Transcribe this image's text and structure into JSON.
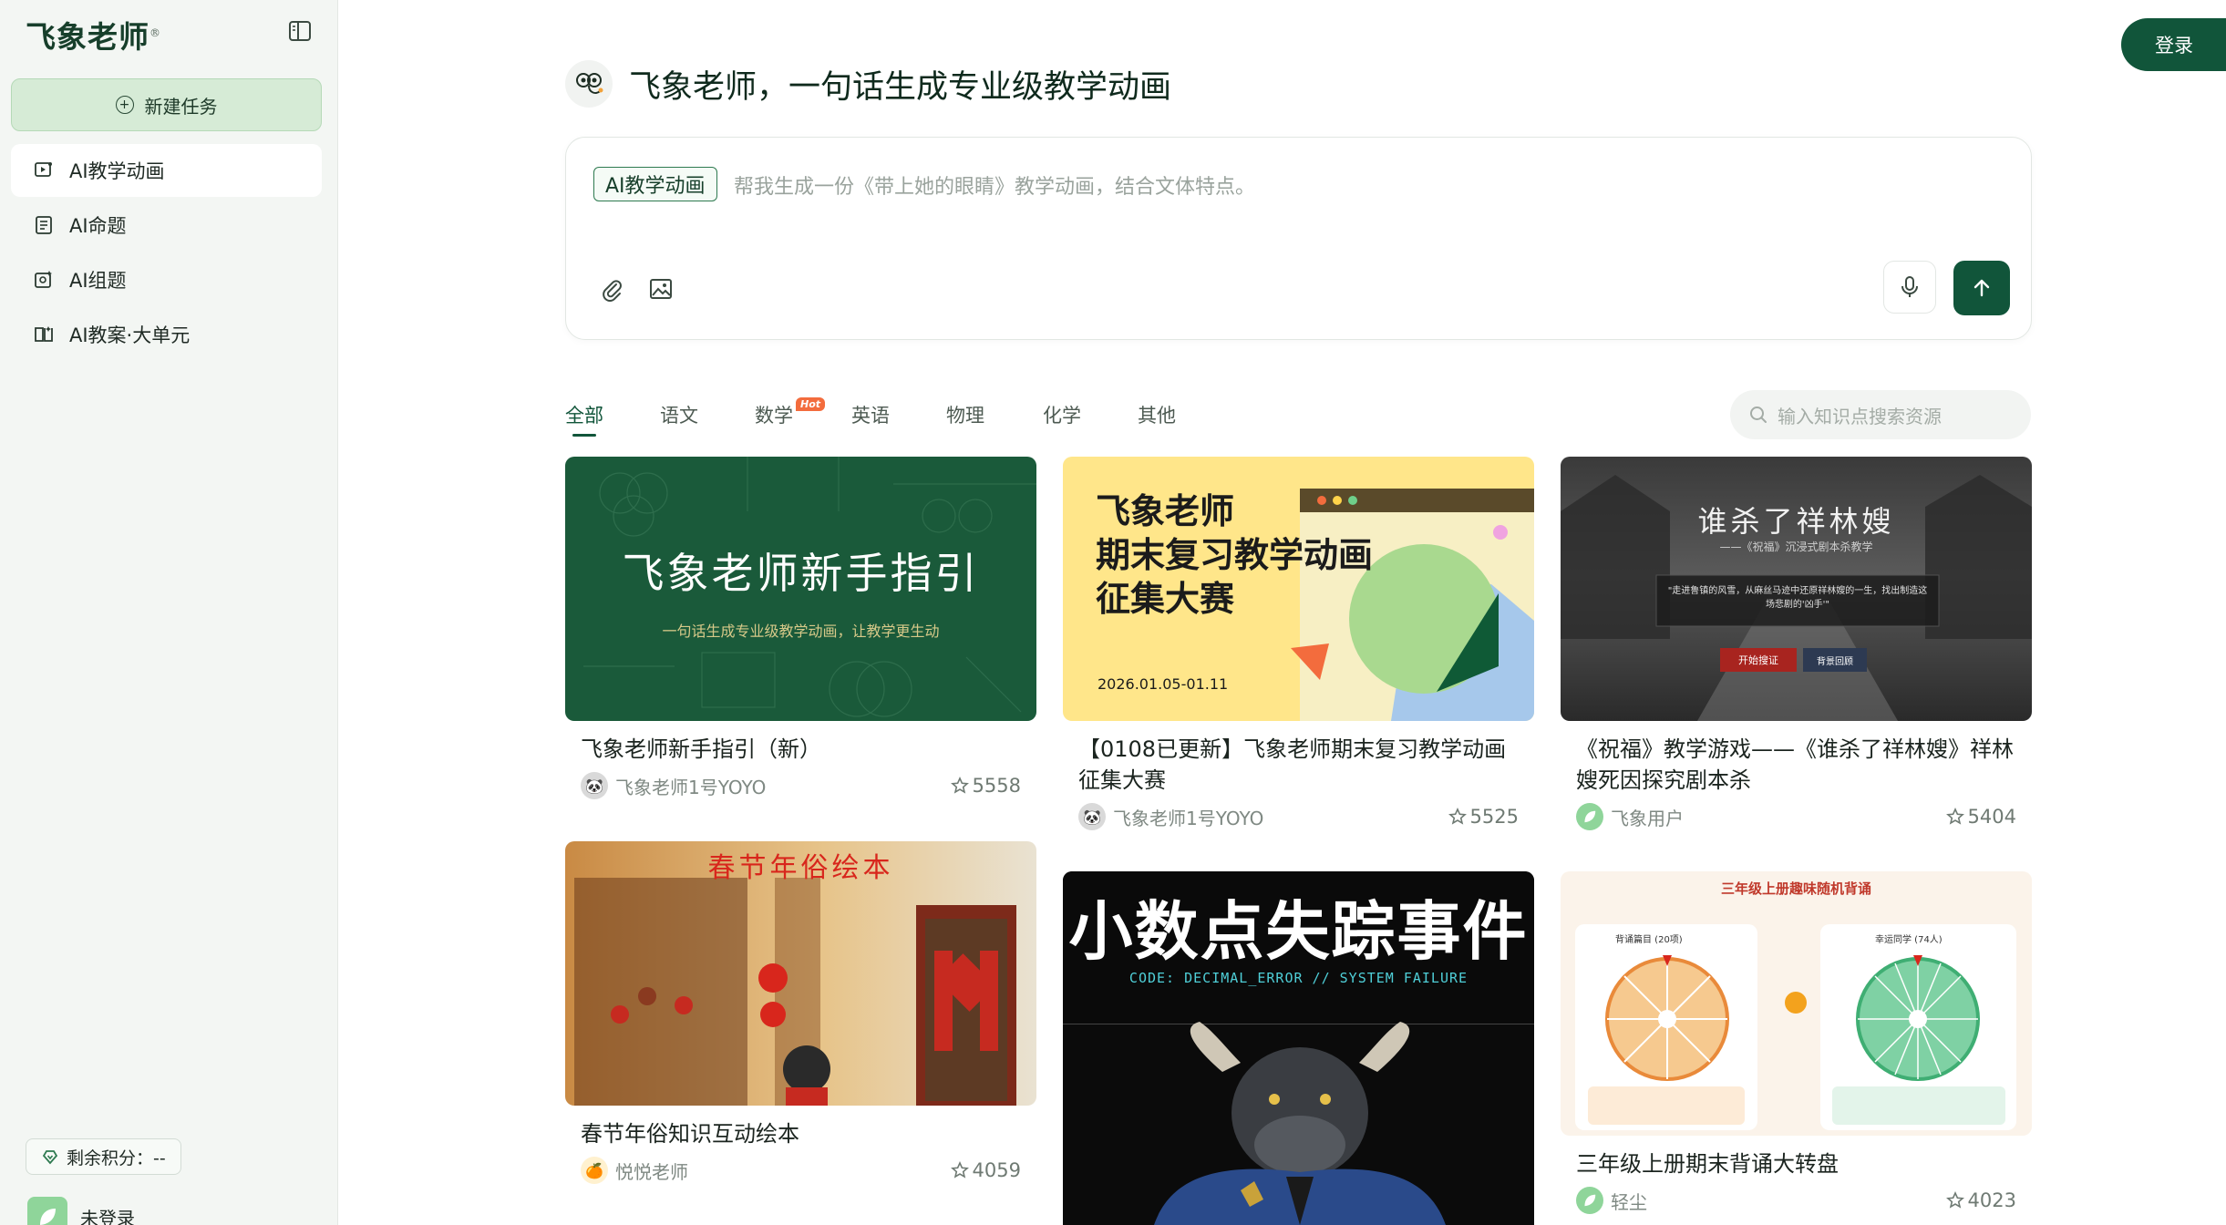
{
  "sidebar": {
    "logo": "飞象老师",
    "logo_mark": "®",
    "new_task": "新建任务",
    "items": [
      {
        "label": "AI教学动画",
        "active": true,
        "icon": "animation-icon"
      },
      {
        "label": "AI命题",
        "active": false,
        "icon": "document-icon"
      },
      {
        "label": "AI组题",
        "active": false,
        "icon": "question-set-icon"
      },
      {
        "label": "AI教案·大单元",
        "active": false,
        "icon": "book-icon"
      }
    ],
    "points_label": "剩余积分：--",
    "user_name": "未登录"
  },
  "header": {
    "login": "登录"
  },
  "hero": {
    "title": "飞象老师，一句话生成专业级教学动画"
  },
  "prompt": {
    "tag": "AI教学动画",
    "placeholder": "帮我生成一份《带上她的眼睛》教学动画，结合文体特点。"
  },
  "tabs": [
    {
      "label": "全部",
      "active": true
    },
    {
      "label": "语文"
    },
    {
      "label": "数学",
      "badge": "Hot"
    },
    {
      "label": "英语"
    },
    {
      "label": "物理"
    },
    {
      "label": "化学"
    },
    {
      "label": "其他"
    }
  ],
  "search": {
    "placeholder": "输入知识点搜索资源"
  },
  "cards": [
    {
      "title": "飞象老师新手指引（新）",
      "author": "飞象老师1号YOYO",
      "likes": "5558",
      "thumb_title": "飞象老师新手指引",
      "thumb_sub": "一句话生成专业级教学动画，让教学更生动"
    },
    {
      "title": "【0108已更新】飞象老师期末复习教学动画征集大赛",
      "author": "飞象老师1号YOYO",
      "likes": "5525",
      "thumb_line1": "飞象老师",
      "thumb_line2": "期末复习教学动画",
      "thumb_line3": "征集大赛",
      "thumb_date": "2026.01.05-01.11"
    },
    {
      "title": "《祝福》教学游戏——《谁杀了祥林嫂》祥林嫂死因探究剧本杀",
      "author": "飞象用户",
      "likes": "5404",
      "thumb_title": "谁杀了祥林嫂",
      "thumb_sub": "——《祝福》沉浸式剧本杀教学",
      "thumb_quote": "\"走进鲁镇的风雪，从麻丝马迹中还原祥林嫂的一生，找出制造这场悲剧的'凶手'\"",
      "thumb_btn1": "开始搜证",
      "thumb_btn2": "背景回顾"
    },
    {
      "title": "春节年俗知识互动绘本",
      "author": "悦悦老师",
      "likes": "4059",
      "thumb_title": "春节年俗绘本"
    },
    {
      "title": "",
      "author": "",
      "likes": "",
      "thumb_title": "小数点失踪事件",
      "thumb_sub": "CODE: DECIMAL_ERROR // SYSTEM FAILURE"
    },
    {
      "title": "三年级上册期末背诵大转盘",
      "author": "轻尘",
      "likes": "4023",
      "thumb_title": "三年级上册趣味随机背诵",
      "thumb_left": "背诵篇目 (20项)",
      "thumb_right": "幸运同学 (74人)"
    }
  ],
  "colors": {
    "brand": "#11553a",
    "sidebar_bg": "#f3f6f3",
    "new_task_bg": "#d6ebd6",
    "hot": "#f36c3d"
  }
}
